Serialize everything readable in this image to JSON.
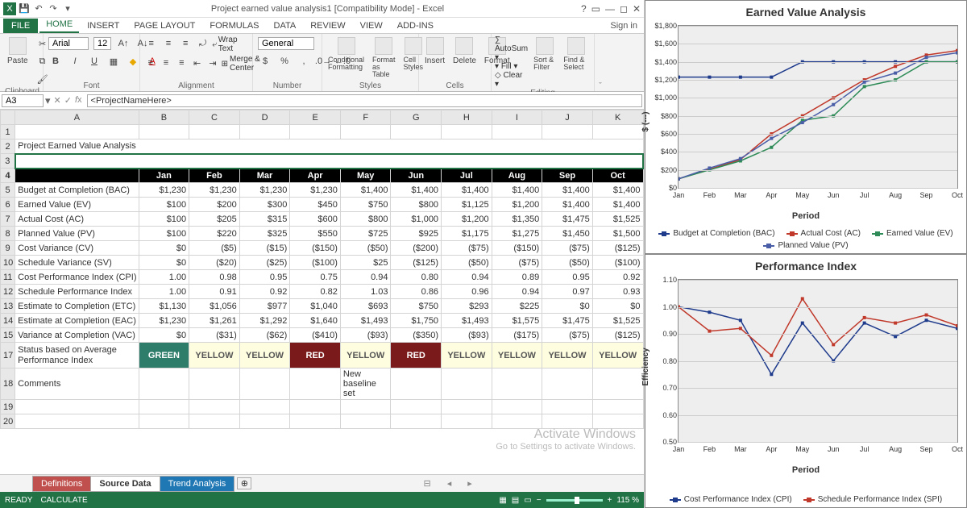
{
  "window": {
    "title": "Project earned value analysis1  [Compatibility Mode] - Excel",
    "signin": "Sign in"
  },
  "tabs": {
    "file": "FILE",
    "items": [
      "HOME",
      "INSERT",
      "PAGE LAYOUT",
      "FORMULAS",
      "DATA",
      "REVIEW",
      "VIEW",
      "ADD-INS"
    ],
    "active": 0
  },
  "ribbon": {
    "paste": "Paste",
    "font_name": "Arial",
    "font_size": "12",
    "wrap": "Wrap Text",
    "merge": "Merge & Center",
    "numfmt": "General",
    "cond_fmt": "Conditional Formatting",
    "fmt_table": "Format as Table",
    "cell_styles": "Cell Styles",
    "insert": "Insert",
    "delete": "Delete",
    "format": "Format",
    "autosum": "AutoSum",
    "fill": "Fill",
    "clear": "Clear",
    "sortfilter": "Sort & Filter",
    "findselect": "Find & Select",
    "groups": {
      "clipboard": "Clipboard",
      "font": "Font",
      "alignment": "Alignment",
      "number": "Number",
      "styles": "Styles",
      "cells": "Cells",
      "editing": "Editing"
    }
  },
  "formula_bar": {
    "cell_ref": "A3",
    "formula": "<ProjectNameHere>"
  },
  "columns": [
    "A",
    "B",
    "C",
    "D",
    "E",
    "F",
    "G",
    "H",
    "I",
    "J",
    "K"
  ],
  "months": [
    "Jan",
    "Feb",
    "Mar",
    "Apr",
    "May",
    "Jun",
    "Jul",
    "Aug",
    "Sep",
    "Oct"
  ],
  "title": "Project Earned Value Analysis",
  "project_name": "<ProjectNameHere>",
  "row_labels": {
    "bac": "Budget at Completion (BAC)",
    "ev": "Earned Value (EV)",
    "ac": "Actual Cost (AC)",
    "pv": "Planned Value (PV)",
    "cv": "Cost Variance (CV)",
    "sv": "Schedule Variance (SV)",
    "cpi": "Cost Performance Index (CPI)",
    "spi": "Schedule Performance Index",
    "etc": "Estimate to Completion (ETC)",
    "eac": "Estimate at Completion (EAC)",
    "vac": "Variance at Completion (VAC)",
    "status": "Status based on Average Performance Index",
    "comments": "Comments"
  },
  "values": {
    "bac": [
      "$1,230",
      "$1,230",
      "$1,230",
      "$1,230",
      "$1,400",
      "$1,400",
      "$1,400",
      "$1,400",
      "$1,400",
      "$1,400"
    ],
    "ev": [
      "$100",
      "$200",
      "$300",
      "$450",
      "$750",
      "$800",
      "$1,125",
      "$1,200",
      "$1,400",
      "$1,400"
    ],
    "ac": [
      "$100",
      "$205",
      "$315",
      "$600",
      "$800",
      "$1,000",
      "$1,200",
      "$1,350",
      "$1,475",
      "$1,525"
    ],
    "pv": [
      "$100",
      "$220",
      "$325",
      "$550",
      "$725",
      "$925",
      "$1,175",
      "$1,275",
      "$1,450",
      "$1,500"
    ],
    "cv": [
      "$0",
      "($5)",
      "($15)",
      "($150)",
      "($50)",
      "($200)",
      "($75)",
      "($150)",
      "($75)",
      "($125)"
    ],
    "sv": [
      "$0",
      "($20)",
      "($25)",
      "($100)",
      "$25",
      "($125)",
      "($50)",
      "($75)",
      "($50)",
      "($100)"
    ],
    "cpi": [
      "1.00",
      "0.98",
      "0.95",
      "0.75",
      "0.94",
      "0.80",
      "0.94",
      "0.89",
      "0.95",
      "0.92"
    ],
    "spi": [
      "1.00",
      "0.91",
      "0.92",
      "0.82",
      "1.03",
      "0.86",
      "0.96",
      "0.94",
      "0.97",
      "0.93"
    ],
    "etc": [
      "$1,130",
      "$1,056",
      "$977",
      "$1,040",
      "$693",
      "$750",
      "$293",
      "$225",
      "$0",
      "$0"
    ],
    "eac": [
      "$1,230",
      "$1,261",
      "$1,292",
      "$1,640",
      "$1,493",
      "$1,750",
      "$1,493",
      "$1,575",
      "$1,475",
      "$1,525"
    ],
    "vac": [
      "$0",
      "($31)",
      "($62)",
      "($410)",
      "($93)",
      "($350)",
      "($93)",
      "($175)",
      "($75)",
      "($125)"
    ],
    "status": [
      "GREEN",
      "YELLOW",
      "YELLOW",
      "RED",
      "YELLOW",
      "RED",
      "YELLOW",
      "YELLOW",
      "YELLOW",
      "YELLOW"
    ],
    "comments": [
      "",
      "",
      "",
      "",
      "New baseline set",
      "",
      "",
      "",
      "",
      ""
    ]
  },
  "sheet_tabs": {
    "def": "Definitions",
    "src": "Source Data",
    "trend": "Trend Analysis"
  },
  "statusbar": {
    "ready": "READY",
    "calc": "CALCULATE",
    "zoom": "115 %"
  },
  "watermark": {
    "l1": "Activate Windows",
    "l2": "Go to Settings to activate Windows."
  },
  "chart_data": [
    {
      "type": "line",
      "title": "Earned Value Analysis",
      "xlabel": "Period",
      "ylabel": "$ (---)",
      "categories": [
        "Jan",
        "Feb",
        "Mar",
        "Apr",
        "May",
        "Jun",
        "Jul",
        "Aug",
        "Sep",
        "Oct"
      ],
      "ylim": [
        0,
        1800
      ],
      "yticks": [
        "$0",
        "$200",
        "$400",
        "$600",
        "$800",
        "$1,000",
        "$1,200",
        "$1,400",
        "$1,600",
        "$1,800"
      ],
      "series": [
        {
          "name": "Budget at Completion (BAC)",
          "color": "#1f3b8c",
          "values": [
            1230,
            1230,
            1230,
            1230,
            1400,
            1400,
            1400,
            1400,
            1400,
            1400
          ]
        },
        {
          "name": "Actual Cost (AC)",
          "color": "#c0392b",
          "values": [
            100,
            205,
            315,
            600,
            800,
            1000,
            1200,
            1350,
            1475,
            1525
          ]
        },
        {
          "name": "Earned Value (EV)",
          "color": "#2e8b57",
          "values": [
            100,
            200,
            300,
            450,
            750,
            800,
            1125,
            1200,
            1400,
            1400
          ]
        },
        {
          "name": "Planned Value (PV)",
          "color": "#4a5ea8",
          "values": [
            100,
            220,
            325,
            550,
            725,
            925,
            1175,
            1275,
            1450,
            1500
          ]
        }
      ]
    },
    {
      "type": "line",
      "title": "Performance Index",
      "xlabel": "Period",
      "ylabel": "Efficiency",
      "categories": [
        "Jan",
        "Feb",
        "Mar",
        "Apr",
        "May",
        "Jun",
        "Jul",
        "Aug",
        "Sep",
        "Oct"
      ],
      "ylim": [
        0.5,
        1.1
      ],
      "yticks": [
        "0.50",
        "0.60",
        "0.70",
        "0.80",
        "0.90",
        "1.00",
        "1.10"
      ],
      "series": [
        {
          "name": "Cost Performance Index (CPI)",
          "color": "#1f3b8c",
          "values": [
            1.0,
            0.98,
            0.95,
            0.75,
            0.94,
            0.8,
            0.94,
            0.89,
            0.95,
            0.92
          ]
        },
        {
          "name": "Schedule Performance Index (SPI)",
          "color": "#c0392b",
          "values": [
            1.0,
            0.91,
            0.92,
            0.82,
            1.03,
            0.86,
            0.96,
            0.94,
            0.97,
            0.93
          ]
        }
      ]
    }
  ]
}
